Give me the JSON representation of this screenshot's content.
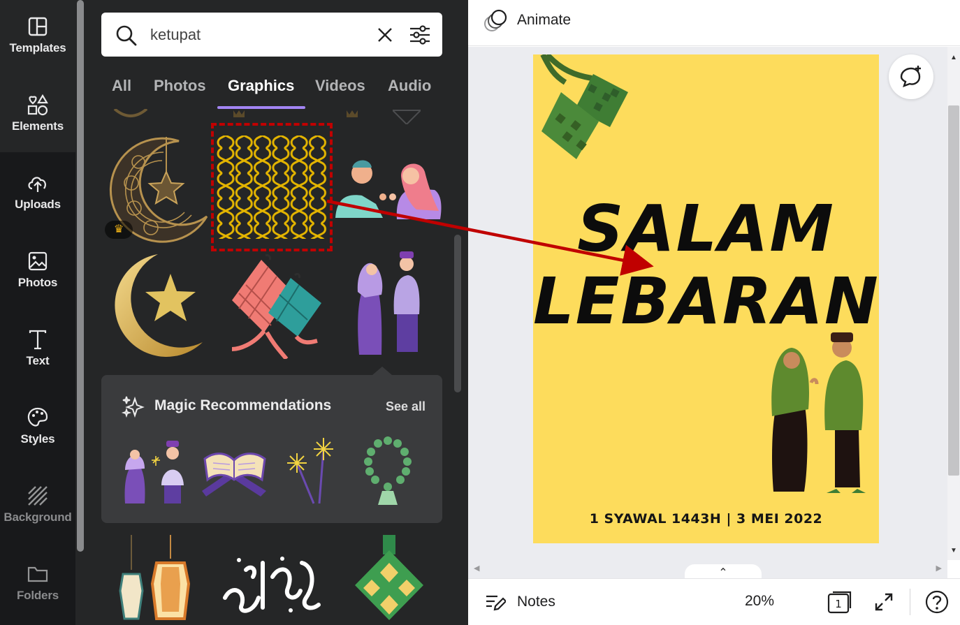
{
  "rail": {
    "items": [
      {
        "label": "Templates",
        "icon": "templates-icon"
      },
      {
        "label": "Elements",
        "icon": "elements-icon"
      },
      {
        "label": "Uploads",
        "icon": "uploads-icon"
      },
      {
        "label": "Photos",
        "icon": "photos-icon"
      },
      {
        "label": "Text",
        "icon": "text-icon"
      },
      {
        "label": "Styles",
        "icon": "styles-icon"
      },
      {
        "label": "Background",
        "icon": "background-icon"
      },
      {
        "label": "Folders",
        "icon": "folders-icon"
      }
    ],
    "active": "Elements"
  },
  "search": {
    "query": "ketupat",
    "icon": "search-icon",
    "clear_icon": "close-icon",
    "filter_icon": "filter-icon"
  },
  "tabs": [
    {
      "label": "All"
    },
    {
      "label": "Photos"
    },
    {
      "label": "Graphics"
    },
    {
      "label": "Videos"
    },
    {
      "label": "Audio"
    }
  ],
  "active_tab": "Graphics",
  "magic": {
    "title": "Magic Recommendations",
    "see_all": "See all"
  },
  "editor": {
    "animate_label": "Animate",
    "design": {
      "line1": "SALAM",
      "line2": "LEBARAN",
      "date_line": "1 SYAWAL 1443H  |  3 MEI 2022"
    },
    "notes_label": "Notes",
    "zoom": "20%",
    "page_count": "1"
  },
  "colors": {
    "rail_bg": "#18191b",
    "panel_bg": "#252627",
    "tab_accent": "#a385f4",
    "canvas_bg": "#ebecf0",
    "page_bg": "#fddc5c",
    "annotation_red": "#c00000"
  }
}
